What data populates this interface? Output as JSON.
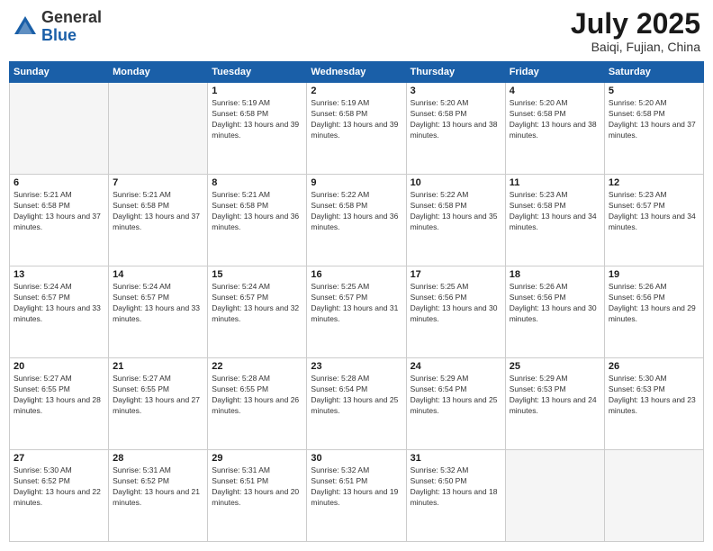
{
  "header": {
    "logo": {
      "general": "General",
      "blue": "Blue"
    },
    "title": "July 2025",
    "location": "Baiqi, Fujian, China"
  },
  "weekdays": [
    "Sunday",
    "Monday",
    "Tuesday",
    "Wednesday",
    "Thursday",
    "Friday",
    "Saturday"
  ],
  "weeks": [
    [
      {
        "day": "",
        "info": ""
      },
      {
        "day": "",
        "info": ""
      },
      {
        "day": "1",
        "sunrise": "5:19 AM",
        "sunset": "6:58 PM",
        "daylight": "13 hours and 39 minutes."
      },
      {
        "day": "2",
        "sunrise": "5:19 AM",
        "sunset": "6:58 PM",
        "daylight": "13 hours and 39 minutes."
      },
      {
        "day": "3",
        "sunrise": "5:20 AM",
        "sunset": "6:58 PM",
        "daylight": "13 hours and 38 minutes."
      },
      {
        "day": "4",
        "sunrise": "5:20 AM",
        "sunset": "6:58 PM",
        "daylight": "13 hours and 38 minutes."
      },
      {
        "day": "5",
        "sunrise": "5:20 AM",
        "sunset": "6:58 PM",
        "daylight": "13 hours and 37 minutes."
      }
    ],
    [
      {
        "day": "6",
        "sunrise": "5:21 AM",
        "sunset": "6:58 PM",
        "daylight": "13 hours and 37 minutes."
      },
      {
        "day": "7",
        "sunrise": "5:21 AM",
        "sunset": "6:58 PM",
        "daylight": "13 hours and 37 minutes."
      },
      {
        "day": "8",
        "sunrise": "5:21 AM",
        "sunset": "6:58 PM",
        "daylight": "13 hours and 36 minutes."
      },
      {
        "day": "9",
        "sunrise": "5:22 AM",
        "sunset": "6:58 PM",
        "daylight": "13 hours and 36 minutes."
      },
      {
        "day": "10",
        "sunrise": "5:22 AM",
        "sunset": "6:58 PM",
        "daylight": "13 hours and 35 minutes."
      },
      {
        "day": "11",
        "sunrise": "5:23 AM",
        "sunset": "6:58 PM",
        "daylight": "13 hours and 34 minutes."
      },
      {
        "day": "12",
        "sunrise": "5:23 AM",
        "sunset": "6:57 PM",
        "daylight": "13 hours and 34 minutes."
      }
    ],
    [
      {
        "day": "13",
        "sunrise": "5:24 AM",
        "sunset": "6:57 PM",
        "daylight": "13 hours and 33 minutes."
      },
      {
        "day": "14",
        "sunrise": "5:24 AM",
        "sunset": "6:57 PM",
        "daylight": "13 hours and 33 minutes."
      },
      {
        "day": "15",
        "sunrise": "5:24 AM",
        "sunset": "6:57 PM",
        "daylight": "13 hours and 32 minutes."
      },
      {
        "day": "16",
        "sunrise": "5:25 AM",
        "sunset": "6:57 PM",
        "daylight": "13 hours and 31 minutes."
      },
      {
        "day": "17",
        "sunrise": "5:25 AM",
        "sunset": "6:56 PM",
        "daylight": "13 hours and 30 minutes."
      },
      {
        "day": "18",
        "sunrise": "5:26 AM",
        "sunset": "6:56 PM",
        "daylight": "13 hours and 30 minutes."
      },
      {
        "day": "19",
        "sunrise": "5:26 AM",
        "sunset": "6:56 PM",
        "daylight": "13 hours and 29 minutes."
      }
    ],
    [
      {
        "day": "20",
        "sunrise": "5:27 AM",
        "sunset": "6:55 PM",
        "daylight": "13 hours and 28 minutes."
      },
      {
        "day": "21",
        "sunrise": "5:27 AM",
        "sunset": "6:55 PM",
        "daylight": "13 hours and 27 minutes."
      },
      {
        "day": "22",
        "sunrise": "5:28 AM",
        "sunset": "6:55 PM",
        "daylight": "13 hours and 26 minutes."
      },
      {
        "day": "23",
        "sunrise": "5:28 AM",
        "sunset": "6:54 PM",
        "daylight": "13 hours and 25 minutes."
      },
      {
        "day": "24",
        "sunrise": "5:29 AM",
        "sunset": "6:54 PM",
        "daylight": "13 hours and 25 minutes."
      },
      {
        "day": "25",
        "sunrise": "5:29 AM",
        "sunset": "6:53 PM",
        "daylight": "13 hours and 24 minutes."
      },
      {
        "day": "26",
        "sunrise": "5:30 AM",
        "sunset": "6:53 PM",
        "daylight": "13 hours and 23 minutes."
      }
    ],
    [
      {
        "day": "27",
        "sunrise": "5:30 AM",
        "sunset": "6:52 PM",
        "daylight": "13 hours and 22 minutes."
      },
      {
        "day": "28",
        "sunrise": "5:31 AM",
        "sunset": "6:52 PM",
        "daylight": "13 hours and 21 minutes."
      },
      {
        "day": "29",
        "sunrise": "5:31 AM",
        "sunset": "6:51 PM",
        "daylight": "13 hours and 20 minutes."
      },
      {
        "day": "30",
        "sunrise": "5:32 AM",
        "sunset": "6:51 PM",
        "daylight": "13 hours and 19 minutes."
      },
      {
        "day": "31",
        "sunrise": "5:32 AM",
        "sunset": "6:50 PM",
        "daylight": "13 hours and 18 minutes."
      },
      {
        "day": "",
        "info": ""
      },
      {
        "day": "",
        "info": ""
      }
    ]
  ]
}
